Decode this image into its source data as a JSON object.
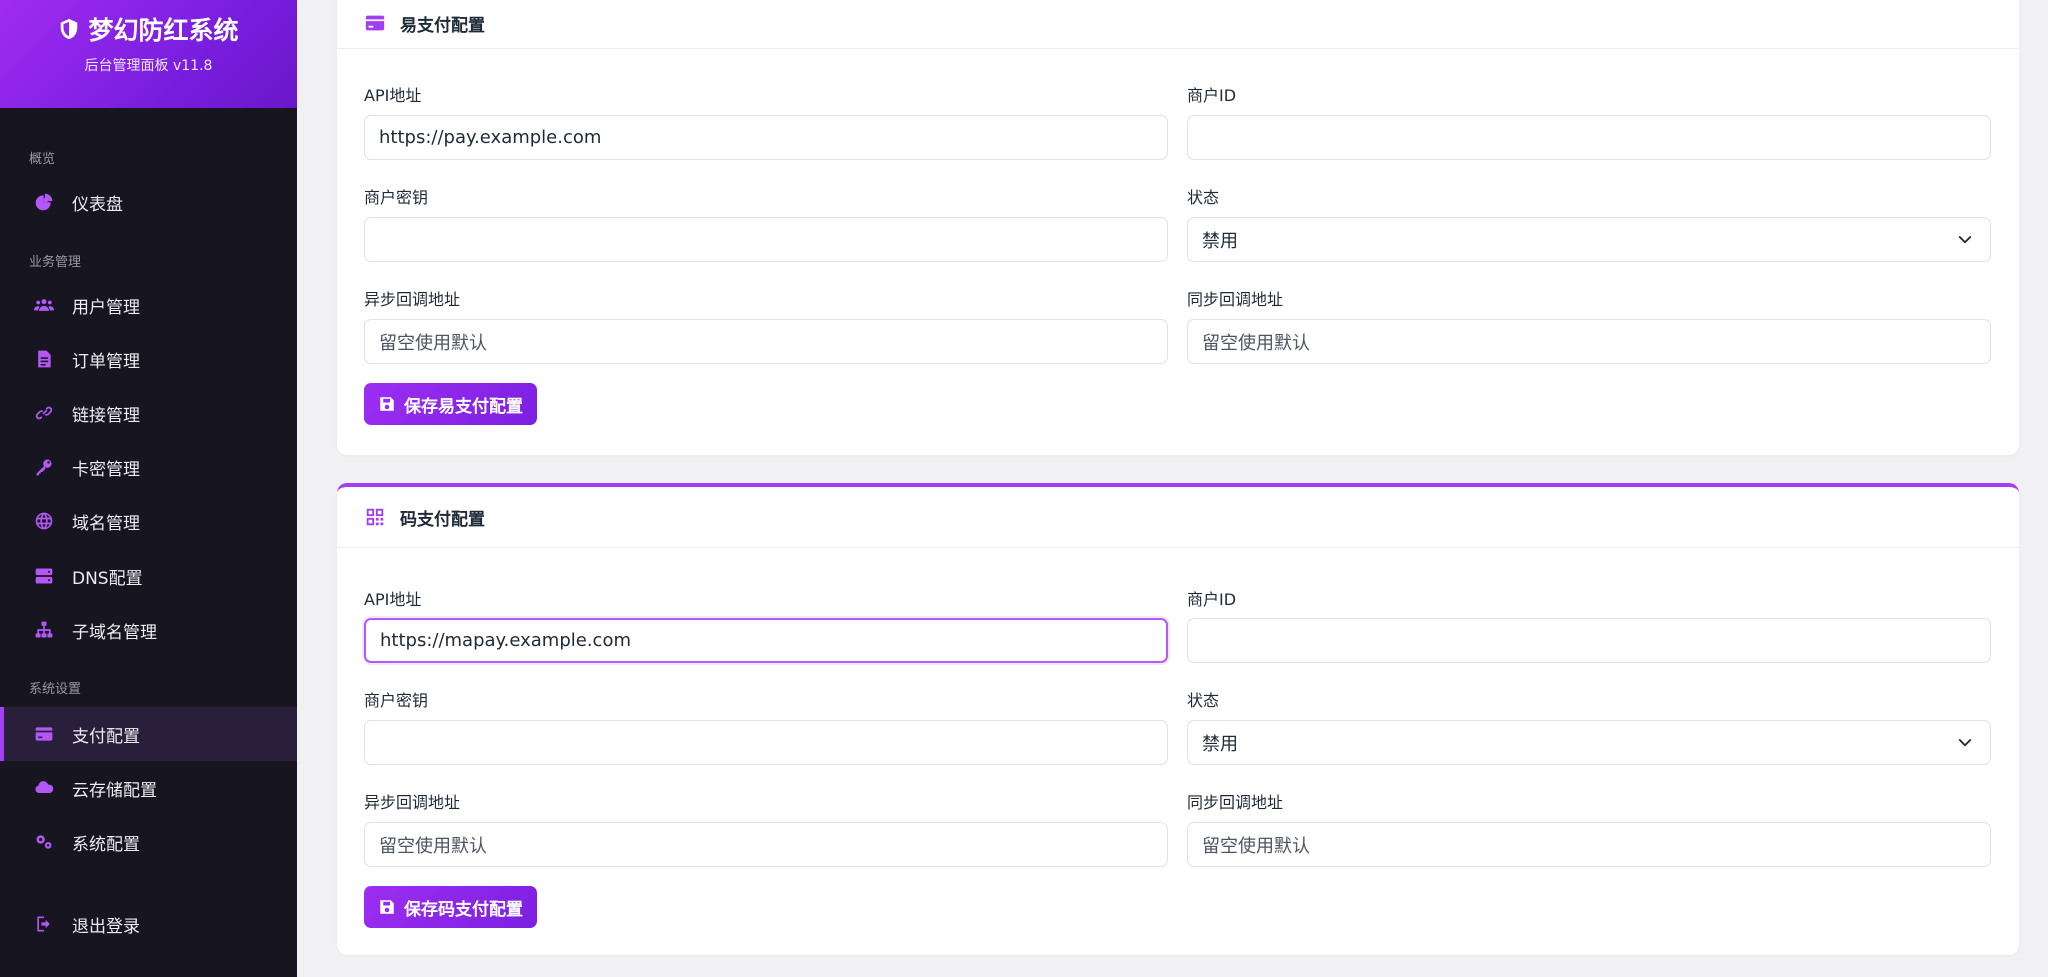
{
  "brand": {
    "title": "梦幻防红系统",
    "subtitle": "后台管理面板 v11.8"
  },
  "sidebar": {
    "sections": [
      "概览",
      "业务管理",
      "系统设置"
    ],
    "items": [
      {
        "label": "仪表盘",
        "icon": "chart-pie-icon"
      },
      {
        "label": "用户管理",
        "icon": "users-icon"
      },
      {
        "label": "订单管理",
        "icon": "file-icon"
      },
      {
        "label": "链接管理",
        "icon": "link-icon"
      },
      {
        "label": "卡密管理",
        "icon": "key-icon"
      },
      {
        "label": "域名管理",
        "icon": "globe-icon"
      },
      {
        "label": "DNS配置",
        "icon": "server-icon"
      },
      {
        "label": "子域名管理",
        "icon": "sitemap-icon"
      },
      {
        "label": "支付配置",
        "icon": "credit-card-icon",
        "active": true
      },
      {
        "label": "云存储配置",
        "icon": "cloud-icon"
      },
      {
        "label": "系统配置",
        "icon": "cogs-icon"
      }
    ],
    "logout": "退出登录"
  },
  "epay": {
    "title": "易支付配置",
    "api_label": "API地址",
    "api_value": "https://pay.example.com",
    "merchant_id_label": "商户ID",
    "merchant_id_value": "",
    "key_label": "商户密钥",
    "key_value": "",
    "status_label": "状态",
    "status_value": "禁用",
    "notify_label": "异步回调地址",
    "notify_placeholder": "留空使用默认",
    "return_label": "同步回调地址",
    "return_placeholder": "留空使用默认",
    "save_label": "保存易支付配置"
  },
  "mapay": {
    "title": "码支付配置",
    "api_label": "API地址",
    "api_value": "https://mapay.example.com",
    "merchant_id_label": "商户ID",
    "merchant_id_value": "",
    "key_label": "商户密钥",
    "key_value": "",
    "status_label": "状态",
    "status_value": "禁用",
    "notify_label": "异步回调地址",
    "notify_placeholder": "留空使用默认",
    "return_label": "同步回调地址",
    "return_placeholder": "留空使用默认",
    "save_label": "保存码支付配置"
  },
  "colors": {
    "accent": "#a33ff3",
    "sidebar_bg": "#17151f",
    "page_bg": "#f1f1f4"
  }
}
